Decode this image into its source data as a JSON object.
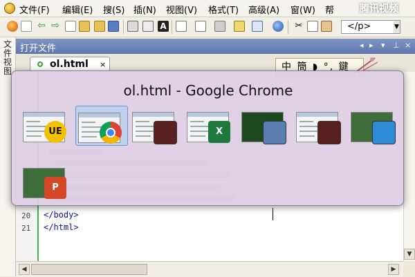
{
  "menu": {
    "items": [
      "文件(F)",
      "编辑(E)",
      "搜(S)",
      "插(N)",
      "视图(V)",
      "格式(T)",
      "高级(A)",
      "窗(W)",
      "帮"
    ],
    "watermark": "腾讯视频"
  },
  "toolbar": {
    "tag_select_value": "</p>",
    "icons": [
      "browser-preview-icon",
      "new-file-icon",
      "back-arrow-icon",
      "forward-arrow-icon",
      "new-document-icon",
      "open-folder-icon",
      "folder-icon",
      "save-icon",
      "print-icon",
      "print-preview-icon",
      "font-icon",
      "table-icon",
      "page-icon",
      "bookmark-icon",
      "column-icon",
      "list-icon",
      "globe-icon",
      "cut-icon",
      "copy-icon",
      "paste-icon"
    ]
  },
  "sidebar": {
    "label": "文件视图"
  },
  "document": {
    "panel_title": "打开文件",
    "tab_label": "ol.html",
    "tab_close": "×",
    "header_controls": [
      "◂",
      "▸",
      "▾",
      "⊥",
      "×"
    ],
    "lines": [
      {
        "num": "20",
        "code": "</body>"
      },
      {
        "num": "21",
        "code": "</html>"
      }
    ]
  },
  "ime": {
    "text": "中 簡 ◗ °, 鍵"
  },
  "task_switcher": {
    "title": "ol.html - Google Chrome",
    "selected_index": 1,
    "items": [
      {
        "app": "UltraEdit",
        "badge": "UE",
        "badge_color": "#f2c200"
      },
      {
        "app": "Google Chrome",
        "badge": "",
        "badge_color": "#db4437"
      },
      {
        "app": "Media player",
        "badge": "",
        "badge_color": "#5a1f1f"
      },
      {
        "app": "Microsoft Excel",
        "badge": "X",
        "badge_color": "#1e7a3c"
      },
      {
        "app": "Document",
        "badge": "",
        "badge_color": "#5a7fb5"
      },
      {
        "app": "Media player",
        "badge": "",
        "badge_color": "#5a1f1f"
      },
      {
        "app": "Desktop",
        "badge": "",
        "badge_color": "#2e8bd6"
      },
      {
        "app": "Microsoft PowerPoint",
        "badge": "P",
        "badge_color": "#d24726"
      }
    ]
  },
  "colors": {
    "switcher_bg": "#dec8e4",
    "selection": "#b4cdf0",
    "gutter_border": "#4caf50",
    "code_text": "#1010a0"
  }
}
